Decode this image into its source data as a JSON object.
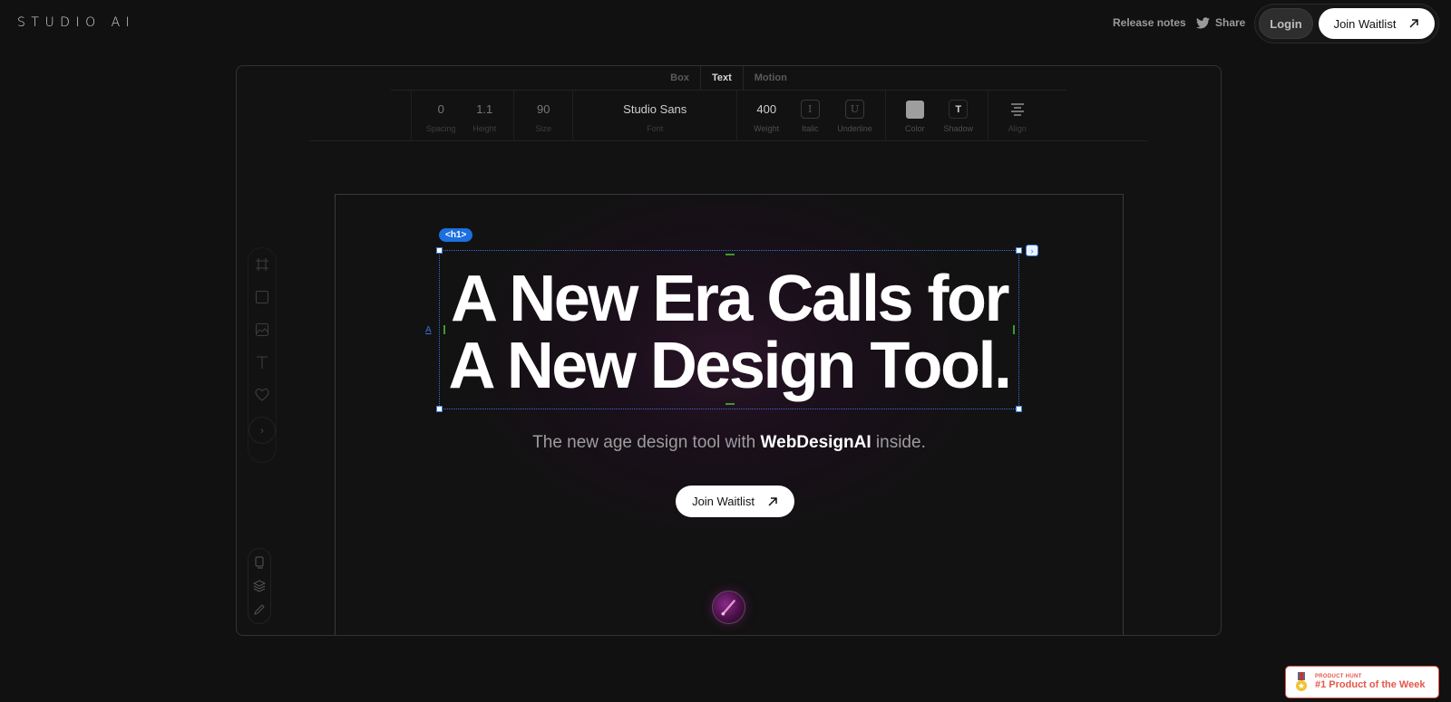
{
  "header": {
    "logo": "STUDIO AI",
    "nav": {
      "release_notes": "Release notes",
      "share": "Share"
    },
    "login_label": "Login",
    "join_label": "Join Waitlist"
  },
  "editor": {
    "tabs": [
      {
        "label": "Box",
        "active": false
      },
      {
        "label": "Text",
        "active": true
      },
      {
        "label": "Motion",
        "active": false
      }
    ],
    "toolbar": {
      "spacing": {
        "value": "0",
        "label": "Spacing"
      },
      "height": {
        "value": "1.1",
        "label": "Height"
      },
      "size": {
        "value": "90",
        "label": "Size"
      },
      "font": {
        "value": "Studio Sans",
        "label": "Font"
      },
      "weight": {
        "value": "400",
        "label": "Weight"
      },
      "italic": {
        "glyph": "I",
        "label": "Italic"
      },
      "underline": {
        "glyph": "U",
        "label": "Underline"
      },
      "color": {
        "value": "#9e9e9e",
        "label": "Color"
      },
      "shadow": {
        "glyph": "T",
        "label": "Shadow"
      },
      "align": {
        "label": "Align"
      }
    },
    "tools": [
      "frame-tool",
      "rectangle-tool",
      "image-tool",
      "text-tool",
      "heart-tool"
    ],
    "secondary_tools": [
      "pages",
      "layers",
      "edit"
    ]
  },
  "canvas": {
    "selection_tag": "<h1>",
    "headline_line1": "A New Era Calls for",
    "headline_line2": "A New Design Tool.",
    "subhead_pre": "The new age design tool with ",
    "subhead_bold": "WebDesignAI",
    "subhead_post": " inside.",
    "cta_label": "Join Waitlist"
  },
  "badge": {
    "small": "PRODUCT HUNT",
    "big": "#1 Product of the Week"
  },
  "colors": {
    "background": "#111111",
    "selection": "#1b6fe0",
    "guide": "#3d9a2c",
    "product_hunt": "#e4574a"
  }
}
